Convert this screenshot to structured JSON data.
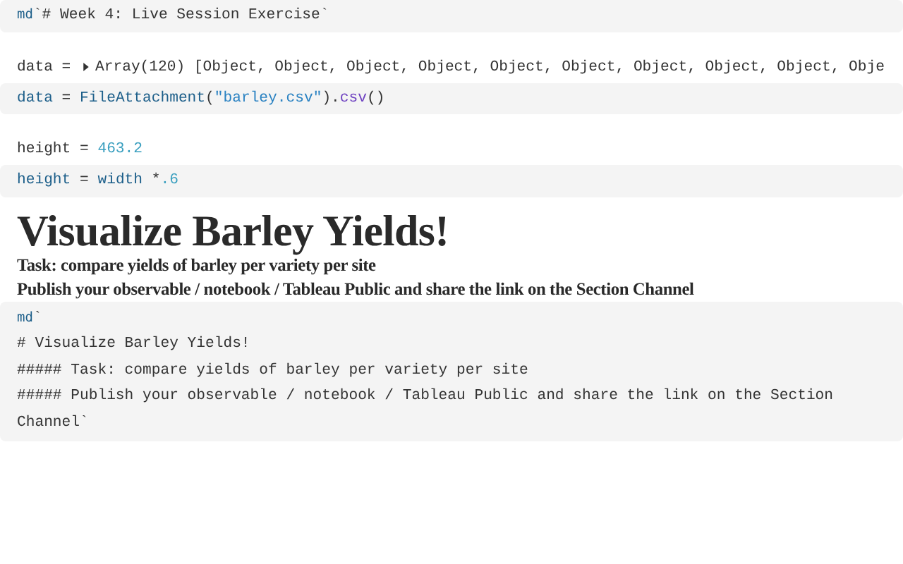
{
  "cells": [
    {
      "kind": "code",
      "lines": [
        [
          {
            "kind": "tag",
            "text": "md"
          },
          {
            "kind": "plain",
            "text": "`# Week 4: Live Session Exercise`"
          }
        ]
      ]
    },
    {
      "kind": "output",
      "lines": [
        [
          {
            "kind": "plain",
            "text": "data = "
          },
          {
            "kind": "toggle",
            "expanded": false
          },
          {
            "kind": "plain",
            "text": "Array(120) [Object, Object, Object, Object, Object, Object, Object, Object, Object, Obje"
          }
        ]
      ]
    },
    {
      "kind": "code",
      "lines": [
        [
          {
            "kind": "name",
            "text": "data"
          },
          {
            "kind": "plain",
            "text": " = "
          },
          {
            "kind": "name",
            "text": "FileAttachment"
          },
          {
            "kind": "plain",
            "text": "("
          },
          {
            "kind": "string",
            "text": "\"barley.csv\""
          },
          {
            "kind": "plain",
            "text": ")."
          },
          {
            "kind": "func",
            "text": "csv"
          },
          {
            "kind": "plain",
            "text": "()"
          }
        ]
      ]
    },
    {
      "kind": "output",
      "lines": [
        [
          {
            "kind": "plain",
            "text": "height = "
          },
          {
            "kind": "number",
            "text": "463.2"
          }
        ]
      ]
    },
    {
      "kind": "code",
      "lines": [
        [
          {
            "kind": "name",
            "text": "height"
          },
          {
            "kind": "plain",
            "text": " = "
          },
          {
            "kind": "name",
            "text": "width"
          },
          {
            "kind": "plain",
            "text": " *"
          },
          {
            "kind": "number",
            "text": ".6"
          }
        ]
      ]
    },
    {
      "kind": "markdown",
      "heading": "Visualize Barley Yields!",
      "subheadings": [
        "Task: compare yields of barley per variety per site",
        "Publish your observable / notebook / Tableau Public and share the link on the Section Channel"
      ]
    },
    {
      "kind": "code",
      "lines": [
        [
          {
            "kind": "tag",
            "text": "md"
          },
          {
            "kind": "plain",
            "text": "`"
          }
        ],
        [
          {
            "kind": "plain",
            "text": "# Visualize Barley Yields!"
          }
        ],
        [
          {
            "kind": "plain",
            "text": "##### Task: compare yields of barley per variety per site"
          }
        ],
        [
          {
            "kind": "plain",
            "text": "##### Publish your observable / notebook / Tableau Public and share the link on the Section"
          }
        ],
        [
          {
            "kind": "plain",
            "text": "Channel`"
          }
        ]
      ]
    }
  ]
}
